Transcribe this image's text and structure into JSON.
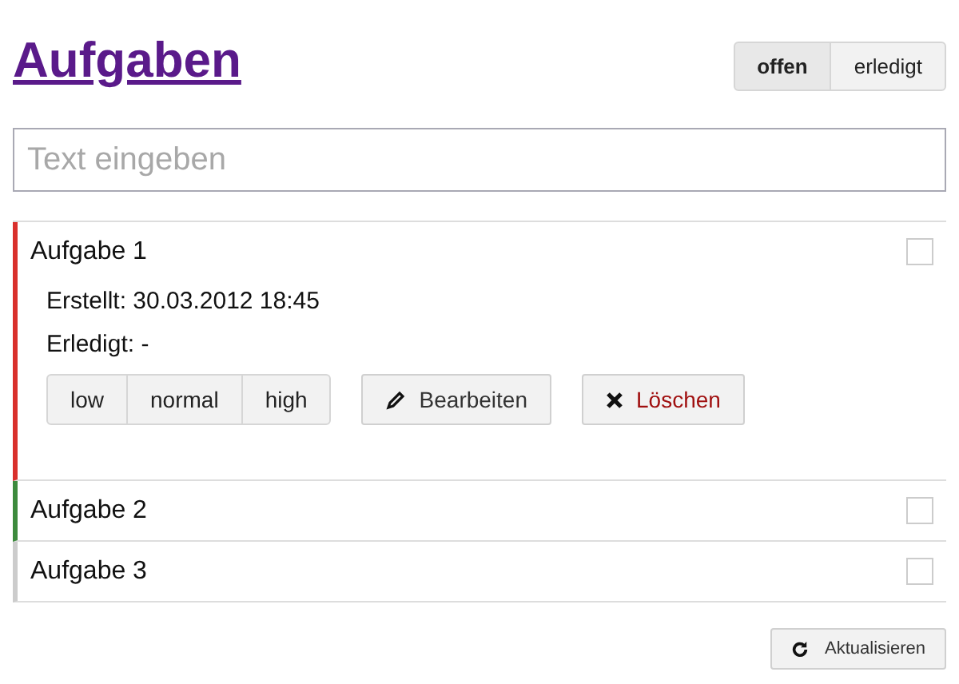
{
  "title": "Aufgaben",
  "filters": [
    {
      "label": "offen",
      "selected": true
    },
    {
      "label": "erledigt",
      "selected": false
    }
  ],
  "input": {
    "placeholder": "Text eingeben"
  },
  "tasks": [
    {
      "title": "Aufgabe 1",
      "color": "#d9302c",
      "checked": false,
      "expanded": true,
      "created": "Erstellt: 30.03.2012 18:45",
      "done": "Erledigt: -",
      "priorities": [
        "low",
        "normal",
        "high"
      ],
      "edit": "Bearbeiten",
      "delete": "Löschen"
    },
    {
      "title": "Aufgabe 2",
      "color": "#3d8a3d",
      "checked": false,
      "expanded": false
    },
    {
      "title": "Aufgabe 3",
      "color": "#cccccc",
      "checked": false,
      "expanded": false
    }
  ],
  "refresh": "Aktualisieren"
}
